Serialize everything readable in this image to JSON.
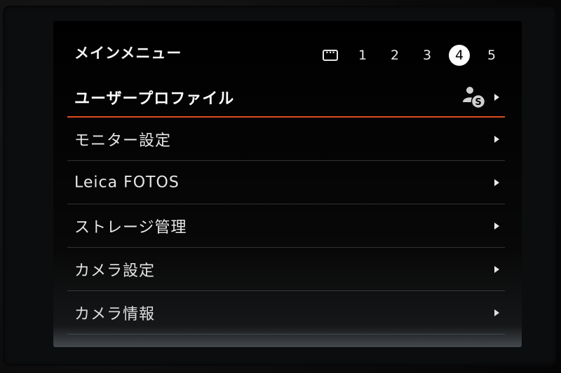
{
  "header": {
    "title": "メインメニュー"
  },
  "page_tabs": {
    "icon": "quick-menu-icon",
    "items": [
      {
        "label": "1",
        "active": false
      },
      {
        "label": "2",
        "active": false
      },
      {
        "label": "3",
        "active": false
      },
      {
        "label": "4",
        "active": true
      },
      {
        "label": "5",
        "active": false
      }
    ]
  },
  "menu": {
    "items": [
      {
        "label": "ユーザープロファイル",
        "selected": true,
        "icon": "user-profile-icon"
      },
      {
        "label": "モニター設定",
        "selected": false
      },
      {
        "label": "Leica FOTOS",
        "selected": false
      },
      {
        "label": "ストレージ管理",
        "selected": false
      },
      {
        "label": "カメラ設定",
        "selected": false
      },
      {
        "label": "カメラ情報",
        "selected": false
      }
    ]
  },
  "colors": {
    "accent": "#e0491b",
    "background": "#000000",
    "text": "#e6e6e6"
  }
}
